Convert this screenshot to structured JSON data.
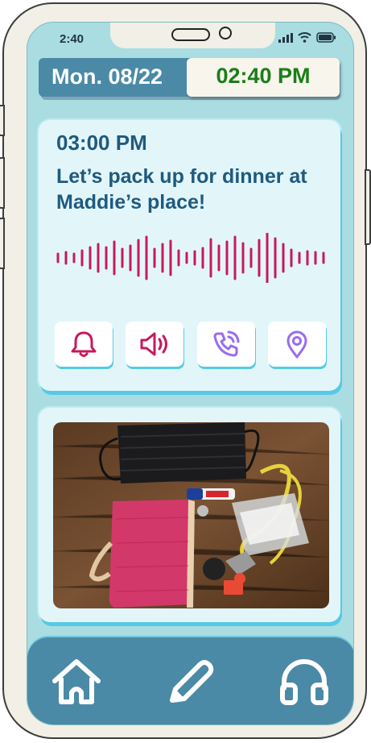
{
  "status_bar": {
    "time": "2:40"
  },
  "header": {
    "date": "Mon. 08/22",
    "clock": "02:40 PM"
  },
  "reminder": {
    "time": "03:00 PM",
    "message": "Let’s pack up for dinner at Maddie’s place!",
    "audio_wave_icon": "audio-waveform",
    "actions": [
      {
        "icon": "bell-icon"
      },
      {
        "icon": "speaker-icon"
      },
      {
        "icon": "phone-call-icon"
      },
      {
        "icon": "location-pin-icon"
      }
    ]
  },
  "photo": {
    "alt": ""
  },
  "nav": {
    "items": [
      {
        "icon": "home-icon"
      },
      {
        "icon": "pencil-icon"
      },
      {
        "icon": "headphones-icon"
      }
    ]
  },
  "colors": {
    "accent": "#4a8aa6",
    "clock_green": "#1b7d18",
    "wave_pink": "#c8185c",
    "icon_purple": "#9a6cf0",
    "screen_bg": "#a9dde2"
  }
}
